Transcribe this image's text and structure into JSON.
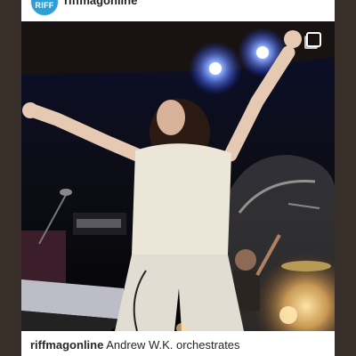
{
  "post": {
    "avatar_text": "RIFF",
    "username": "riffmagonline",
    "caption_user": "riffmagonline",
    "caption_text": "Andrew W.K. orchestrates",
    "photo_alt": "Concert photo"
  },
  "icons": {
    "multi_photo": "multiple-photos-icon"
  },
  "colors": {
    "avatar_bg": "#2d9fd8",
    "stage_light": "#3a6dff"
  }
}
